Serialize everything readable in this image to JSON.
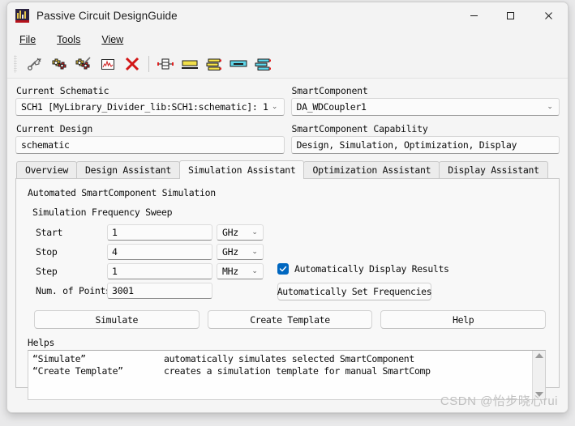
{
  "window": {
    "title": "Passive Circuit DesignGuide",
    "icon": "waveform-app-icon",
    "controls": {
      "minimize": "minimize-icon",
      "maximize": "maximize-icon",
      "close": "close-icon"
    }
  },
  "menubar": {
    "items": [
      {
        "label": "File",
        "mnemonic": "F"
      },
      {
        "label": "Tools",
        "mnemonic": "T"
      },
      {
        "label": "View",
        "mnemonic": "V"
      }
    ]
  },
  "toolbar": {
    "buttons": [
      {
        "name": "design-tool-icon",
        "title": "Design"
      },
      {
        "name": "gears-red-icon",
        "title": "Auto Design"
      },
      {
        "name": "gears-blue-icon",
        "title": "Auto Simulate"
      },
      {
        "name": "plot-icon",
        "title": "Display Results"
      },
      {
        "name": "delete-red-x-icon",
        "title": "Delete"
      },
      {
        "name": "via-component-icon",
        "title": "Via"
      },
      {
        "name": "microstrip-line-icon",
        "title": "Microstrip Line"
      },
      {
        "name": "coupled-line-icon",
        "title": "Coupled Lines"
      },
      {
        "name": "stripline-icon",
        "title": "Stripline"
      },
      {
        "name": "coupler-icon",
        "title": "Coupler"
      }
    ]
  },
  "left_panel": {
    "schematic_label": "Current Schematic",
    "schematic_value": "SCH1 [MyLibrary_Divider_lib:SCH1:schematic]: 1",
    "design_label": "Current Design",
    "design_value": "schematic"
  },
  "right_panel": {
    "component_label": "SmartComponent",
    "component_value": "DA_WDCoupler1",
    "capability_label": "SmartComponent Capability",
    "capability_value": "Design, Simulation, Optimization, Display"
  },
  "tabs": [
    {
      "label": "Overview",
      "active": false
    },
    {
      "label": "Design Assistant",
      "active": false
    },
    {
      "label": "Simulation Assistant",
      "active": true
    },
    {
      "label": "Optimization Assistant",
      "active": false
    },
    {
      "label": "Display Assistant",
      "active": false
    }
  ],
  "panel": {
    "section_title": "Automated SmartComponent Simulation",
    "sweep_title": "Simulation Frequency Sweep",
    "rows": [
      {
        "label": "Start",
        "value": "1",
        "unit": "GHz"
      },
      {
        "label": "Stop",
        "value": "4",
        "unit": "GHz"
      },
      {
        "label": "Step",
        "value": "1",
        "unit": "MHz"
      }
    ],
    "points": {
      "label": "Num. of Points",
      "value": "3001"
    },
    "auto_display": {
      "label": "Automatically Display Results",
      "checked": true
    },
    "auto_set_button": "Automatically Set Frequencies",
    "actions": [
      {
        "label": "Simulate",
        "name": "simulate-button"
      },
      {
        "label": "Create Template",
        "name": "create-template-button"
      },
      {
        "label": "Help",
        "name": "help-button"
      }
    ],
    "helps": {
      "label": "Helps",
      "lines": [
        {
          "key": "“Simulate”",
          "desc": "automatically simulates selected SmartComponent"
        },
        {
          "key": "“Create Template”",
          "desc": "creates a simulation template for manual SmartComp"
        }
      ]
    }
  },
  "watermark": "CSDN @怡步晓心rui",
  "colors": {
    "accent": "#0067c0",
    "window_bg": "#f3f3f3",
    "panel_bg": "#f8f8f8"
  }
}
